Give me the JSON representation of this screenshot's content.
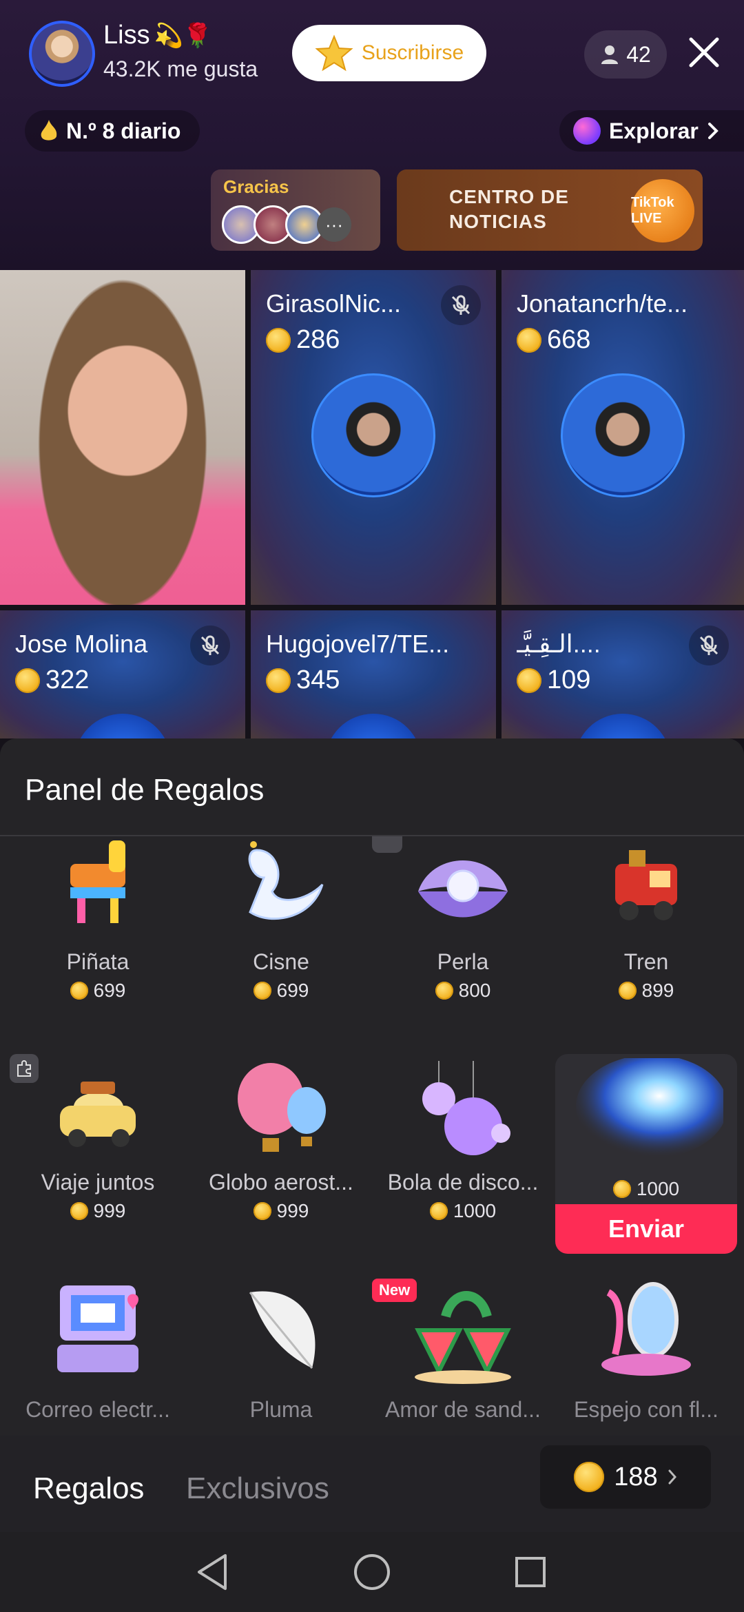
{
  "header": {
    "host_name": "Liss",
    "host_name_emojis": "💫🌹",
    "likes": "43.2K me gusta",
    "subscribe_label": "Suscribirse",
    "viewer_count": "42",
    "rank_label": "N.º 8 diario",
    "explore_label": "Explorar"
  },
  "banners": {
    "thanks_title": "Gracias",
    "thanks_more": "···",
    "news_title_line1": "CENTRO DE",
    "news_title_line2": "NOTICIAS",
    "news_badge": "TikTok LIVE"
  },
  "guests": [
    {
      "name": "",
      "coins": "",
      "muted": false,
      "is_host_cam": true
    },
    {
      "name": "GirasolNic...",
      "coins": "286",
      "muted": true
    },
    {
      "name": "Jonatancrh/te...",
      "coins": "668",
      "muted": false
    },
    {
      "name": "Jose Molina",
      "coins": "322",
      "muted": true
    },
    {
      "name": "Hugojovel7/TE...",
      "coins": "345",
      "muted": false
    },
    {
      "name": "الـقِـيَّـ....",
      "coins": "109",
      "muted": true
    }
  ],
  "gift_panel": {
    "title": "Panel de Regalos",
    "gifts": [
      {
        "name": "Piñata",
        "price": "699",
        "icon": "pinata-icon"
      },
      {
        "name": "Cisne",
        "price": "699",
        "icon": "swan-icon"
      },
      {
        "name": "Perla",
        "price": "800",
        "icon": "pearl-icon"
      },
      {
        "name": "Tren",
        "price": "899",
        "icon": "train-icon"
      },
      {
        "name": "Viaje juntos",
        "price": "999",
        "icon": "car-icon"
      },
      {
        "name": "Globo aerost...",
        "price": "999",
        "icon": "hot-air-balloon-icon"
      },
      {
        "name": "Bola de disco...",
        "price": "1000",
        "icon": "disco-ball-icon"
      },
      {
        "name": "",
        "price": "1000",
        "icon": "galaxy-icon",
        "selected": true
      },
      {
        "name": "Correo electr...",
        "price": "",
        "icon": "computer-mail-icon"
      },
      {
        "name": "Pluma",
        "price": "",
        "icon": "feather-icon"
      },
      {
        "name": "Amor de sand...",
        "price": "",
        "icon": "watermelon-icon",
        "tag": "New"
      },
      {
        "name": "Espejo con fl...",
        "price": "",
        "icon": "mirror-icon"
      }
    ],
    "send_label": "Enviar"
  },
  "tabs": {
    "gifts": "Regalos",
    "exclusive": "Exclusivos",
    "balance": "188"
  },
  "colors": {
    "accent": "#fe2c55",
    "coin": "#f2b01c",
    "panel_bg": "#252427"
  }
}
